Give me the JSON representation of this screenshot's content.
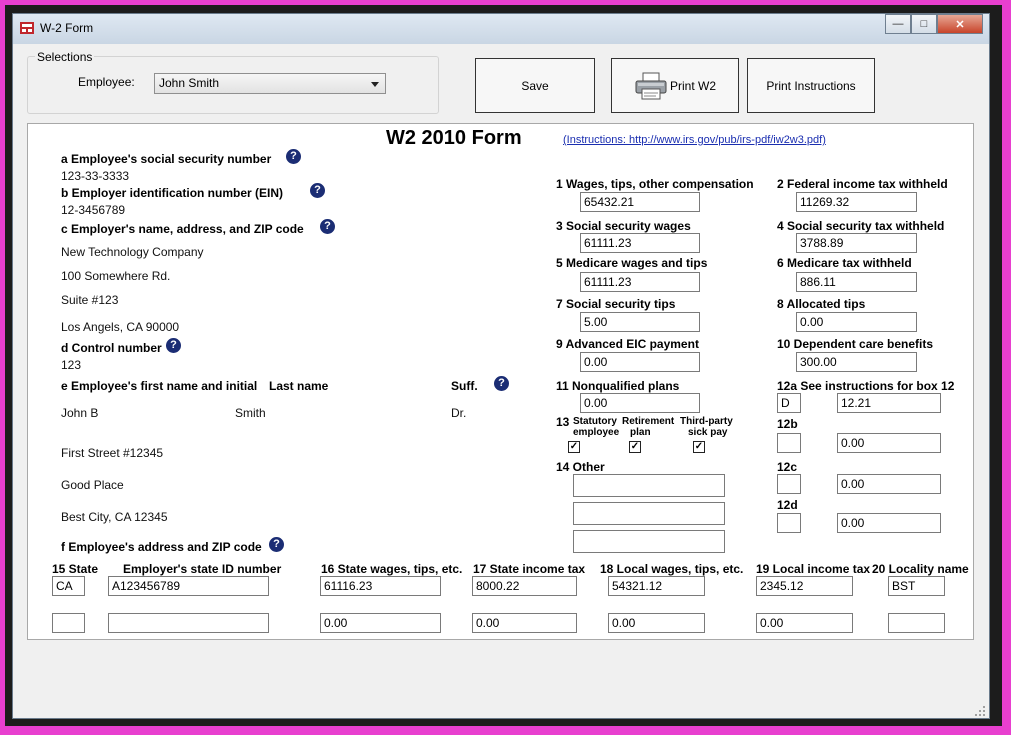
{
  "window": {
    "title": "W-2 Form"
  },
  "selections": {
    "legend": "Selections",
    "employee_label": "Employee:",
    "employee_value": "John Smith"
  },
  "toolbar": {
    "save": "Save",
    "print_w2": "Print W2",
    "print_instructions": "Print Instructions"
  },
  "form": {
    "title": "W2 2010 Form",
    "instructions_link": "(Instructions: http://www.irs.gov/pub/irs-pdf/iw2w3.pdf)",
    "a": {
      "label": "a Employee's social security number",
      "value": "123-33-3333"
    },
    "b": {
      "label": "b Employer identification number (EIN)",
      "value": "12-3456789"
    },
    "c": {
      "label": "c Employer's name, address, and ZIP code",
      "lines": [
        "New Technology Company",
        "100 Somewhere Rd.",
        "Suite #123",
        "Los Angels, CA 90000"
      ]
    },
    "d": {
      "label": "d Control number",
      "value": "123"
    },
    "e": {
      "label": "e Employee's first name and initial",
      "last_label": "Last name",
      "suff_label": "Suff.",
      "first": "John B",
      "last": "Smith",
      "suff": "Dr.",
      "address_lines": [
        "First Street #12345",
        "Good Place",
        "Best City, CA 12345"
      ]
    },
    "f": {
      "label": "f Employee's address and ZIP code"
    },
    "box1": {
      "label": "1 Wages, tips, other compensation",
      "value": "65432.21"
    },
    "box2": {
      "label": "2 Federal income tax withheld",
      "value": "11269.32"
    },
    "box3": {
      "label": "3 Social security wages",
      "value": "61111.23"
    },
    "box4": {
      "label": "4 Social security tax withheld",
      "value": "3788.89"
    },
    "box5": {
      "label": "5 Medicare wages and tips",
      "value": "61111.23"
    },
    "box6": {
      "label": "6 Medicare tax withheld",
      "value": "886.11"
    },
    "box7": {
      "label": "7 Social security tips",
      "value": "5.00"
    },
    "box8": {
      "label": "8 Allocated tips",
      "value": "0.00"
    },
    "box9": {
      "label": "9 Advanced EIC payment",
      "value": "0.00"
    },
    "box10": {
      "label": "10 Dependent care benefits",
      "value": "300.00"
    },
    "box11": {
      "label": "11 Nonqualified plans",
      "value": "0.00"
    },
    "box12a": {
      "label": "12a See instructions for box 12",
      "code": "D",
      "value": "12.21"
    },
    "box12b": {
      "label": "12b",
      "code": "",
      "value": "0.00"
    },
    "box12c": {
      "label": "12c",
      "code": "",
      "value": "0.00"
    },
    "box12d": {
      "label": "12d",
      "code": "",
      "value": "0.00"
    },
    "box13": {
      "label": "13",
      "statutory_l1": "Statutory",
      "statutory_l2": "employee",
      "retirement_l1": "Retirement",
      "retirement_l2": "plan",
      "thirdparty_l1": "Third-party",
      "thirdparty_l2": "sick pay",
      "check_mark": "✓"
    },
    "box14": {
      "label": "14 Other"
    },
    "state": {
      "h15": "15 State",
      "hid": "Employer's state ID number",
      "h16": "16 State wages, tips, etc.",
      "h17": "17 State income tax",
      "h18": "18 Local wages, tips, etc.",
      "h19": "19 Local income tax",
      "h20": "20 Locality name",
      "rows": [
        {
          "state": "CA",
          "id": "A123456789",
          "wages": "61116.23",
          "tax": "8000.22",
          "local_wages": "54321.12",
          "local_tax": "2345.12",
          "locality": "BST"
        },
        {
          "state": "",
          "id": "",
          "wages": "0.00",
          "tax": "0.00",
          "local_wages": "0.00",
          "local_tax": "0.00",
          "locality": ""
        }
      ]
    }
  },
  "icons": {
    "help": "?",
    "minimize": "—",
    "maximize": "□",
    "close": "✕"
  }
}
